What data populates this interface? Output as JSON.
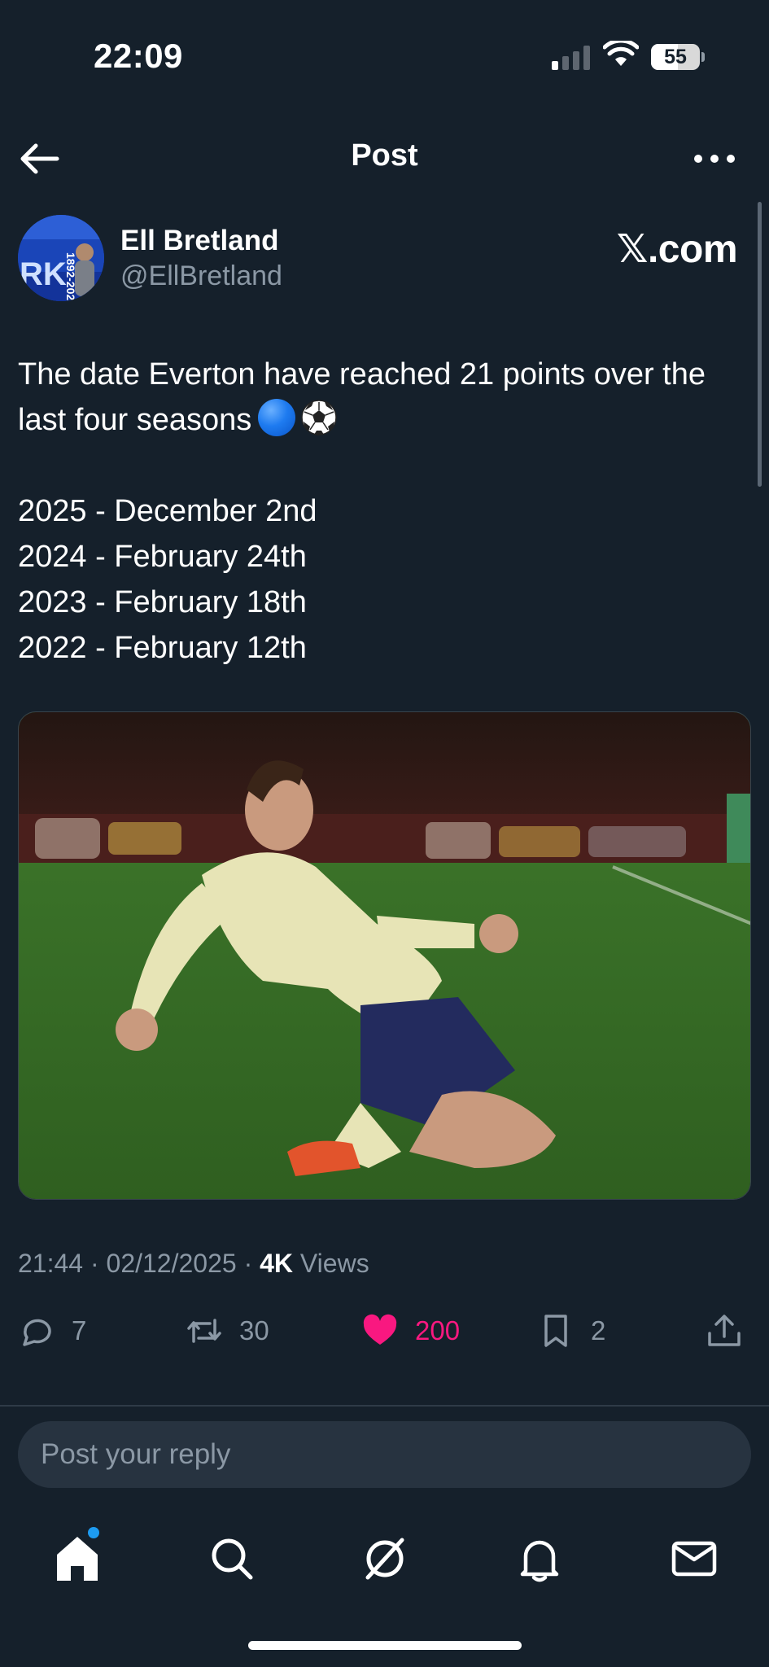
{
  "status_bar": {
    "time": "22:09",
    "battery_percent": "55",
    "battery_level": 0.55,
    "signal_icon": "cellular-signal-icon",
    "wifi_icon": "wifi-icon"
  },
  "header": {
    "title": "Post",
    "back_icon": "arrow-left-icon",
    "more_icon": "more-horizontal-icon"
  },
  "post": {
    "author_name": "Ell Bretland",
    "author_handle": "@EllBretland",
    "watermark": "𝕏.com",
    "text_lines": [
      "The date Everton have reached 21 points over the",
      "last four seasons"
    ],
    "emojis": [
      "🔵",
      "⚽"
    ],
    "list_lines": [
      "2025 - December 2nd",
      "2024 - February 24th",
      "2023 - February 18th",
      "2022 - February 12th"
    ],
    "meta": {
      "time": "21:44",
      "date": "02/12/2025",
      "views_count": "4K",
      "views_label": "Views"
    },
    "actions": {
      "replies": "7",
      "reposts": "30",
      "likes": "200",
      "bookmarks": "2"
    }
  },
  "reply": {
    "placeholder": "Post your reply"
  },
  "bottom_nav": {
    "tabs": [
      "home-icon",
      "search-icon",
      "grok-icon",
      "notifications-bell-icon",
      "messages-envelope-icon"
    ]
  },
  "colors": {
    "background": "#15202b",
    "like_pink": "#f91880",
    "muted": "#8b98a5",
    "accent_blue": "#1d9bf0"
  }
}
